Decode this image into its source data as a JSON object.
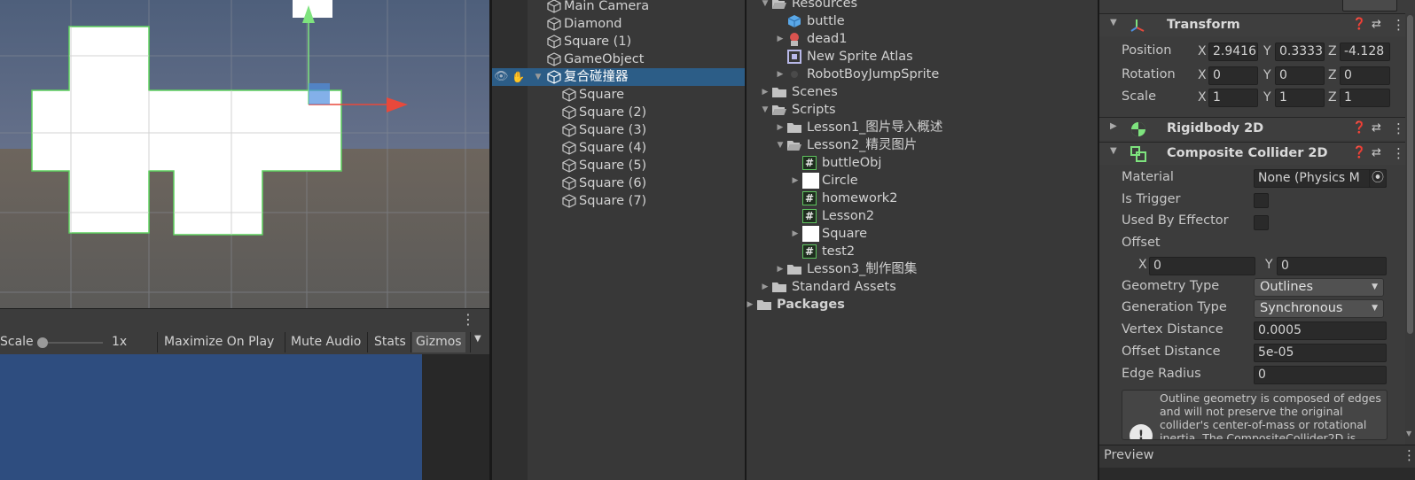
{
  "scene_view": {
    "gizmo_axes": [
      "y",
      "x"
    ]
  },
  "game_toolbar": {
    "scale_label": "Scale",
    "scale_value": "1x",
    "maximize_on_play": "Maximize On Play",
    "mute_audio": "Mute Audio",
    "stats": "Stats",
    "gizmos": "Gizmos",
    "kebab_icon": "kebab-icon"
  },
  "hierarchy": {
    "rows": [
      {
        "label": "Main Camera",
        "selected": false
      },
      {
        "label": "Diamond",
        "selected": false
      },
      {
        "label": "Square (1)",
        "selected": false
      },
      {
        "label": "GameObject",
        "selected": false
      },
      {
        "label": "复合碰撞器",
        "selected": true
      },
      {
        "label": "Square",
        "selected": false
      },
      {
        "label": "Square (2)",
        "selected": false
      },
      {
        "label": "Square (3)",
        "selected": false
      },
      {
        "label": "Square (4)",
        "selected": false
      },
      {
        "label": "Square (5)",
        "selected": false
      },
      {
        "label": "Square (6)",
        "selected": false
      },
      {
        "label": "Square (7)",
        "selected": false
      }
    ]
  },
  "project": {
    "rows": [
      {
        "label": "Resources",
        "icon": "folder-open-icon",
        "arrow": "expanded"
      },
      {
        "label": "buttle",
        "icon": "prefab-cube-icon",
        "arrow": "none"
      },
      {
        "label": "dead1",
        "icon": "character-sprite-icon",
        "arrow": "collapsed"
      },
      {
        "label": "New Sprite Atlas",
        "icon": "sprite-atlas-icon",
        "arrow": "none"
      },
      {
        "label": "RobotBoyJumpSprite",
        "icon": "sprite-icon",
        "arrow": "collapsed"
      },
      {
        "label": "Scenes",
        "icon": "folder-icon",
        "arrow": "collapsed"
      },
      {
        "label": "Scripts",
        "icon": "folder-open-icon",
        "arrow": "expanded"
      },
      {
        "label": "Lesson1_图片导入概述",
        "icon": "folder-icon",
        "arrow": "collapsed"
      },
      {
        "label": "Lesson2_精灵图片",
        "icon": "folder-open-icon",
        "arrow": "expanded"
      },
      {
        "label": "buttleObj",
        "icon": "script-icon",
        "arrow": "none"
      },
      {
        "label": "Circle",
        "icon": "white-sprite-icon",
        "arrow": "collapsed"
      },
      {
        "label": "homework2",
        "icon": "script-icon",
        "arrow": "none"
      },
      {
        "label": "Lesson2",
        "icon": "script-icon",
        "arrow": "none"
      },
      {
        "label": "Square",
        "icon": "white-sprite-icon",
        "arrow": "collapsed"
      },
      {
        "label": "test2",
        "icon": "script-icon",
        "arrow": "none"
      },
      {
        "label": "Lesson3_制作图集",
        "icon": "folder-icon",
        "arrow": "collapsed"
      },
      {
        "label": "Standard Assets",
        "icon": "folder-icon",
        "arrow": "collapsed"
      },
      {
        "label": "Packages",
        "icon": "folder-icon",
        "arrow": "collapsed"
      }
    ]
  },
  "inspector": {
    "transform": {
      "title": "Transform",
      "position_label": "Position",
      "rotation_label": "Rotation",
      "scale_label": "Scale",
      "position": {
        "x": "2.9416",
        "y": "0.3333",
        "z": "-4.128"
      },
      "rotation": {
        "x": "0",
        "y": "0",
        "z": "0"
      },
      "scale": {
        "x": "1",
        "y": "1",
        "z": "1"
      },
      "axis_x": "X",
      "axis_y": "Y",
      "axis_z": "Z"
    },
    "rigidbody": {
      "title": "Rigidbody 2D"
    },
    "composite": {
      "title": "Composite Collider 2D",
      "material_label": "Material",
      "material_value": "None (Physics M",
      "is_trigger_label": "Is Trigger",
      "used_by_effector_label": "Used By Effector",
      "offset_label": "Offset",
      "offset": {
        "x": "0",
        "y": "0"
      },
      "geometry_type_label": "Geometry Type",
      "geometry_type_value": "Outlines",
      "generation_type_label": "Generation Type",
      "generation_type_value": "Synchronous",
      "vertex_distance_label": "Vertex Distance",
      "vertex_distance_value": "0.0005",
      "offset_distance_label": "Offset Distance",
      "offset_distance_value": "5e-05",
      "edge_radius_label": "Edge Radius",
      "edge_radius_value": "0",
      "warning_text": "Outline geometry is composed of edges and will not preserve the original collider's center-of-mass or rotational inertia. The CompositeCollider2D is"
    },
    "preview_label": "Preview"
  },
  "colors": {
    "selection": "#2c5d87",
    "collider_outline": "#5ed15e",
    "gizmo_y": "#7ee37e",
    "gizmo_x": "#e8493b"
  }
}
